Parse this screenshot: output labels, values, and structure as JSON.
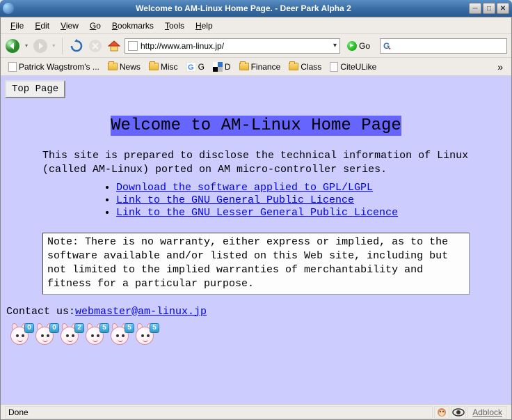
{
  "window": {
    "title": "Welcome to AM-Linux Home Page. - Deer Park Alpha 2"
  },
  "menubar": {
    "file": "File",
    "edit": "Edit",
    "view": "View",
    "go": "Go",
    "bookmarks": "Bookmarks",
    "tools": "Tools",
    "help": "Help"
  },
  "toolbar": {
    "url": "http://www.am-linux.jp/",
    "go_label": "Go",
    "search_value": ""
  },
  "bookmarks": [
    {
      "label": "Patrick Wagstrom's ...",
      "icon": "page"
    },
    {
      "label": "News",
      "icon": "folder"
    },
    {
      "label": "Misc",
      "icon": "folder"
    },
    {
      "label": "G",
      "icon": "g"
    },
    {
      "label": "D",
      "icon": "d"
    },
    {
      "label": "Finance",
      "icon": "folder"
    },
    {
      "label": "Class",
      "icon": "folder"
    },
    {
      "label": "CiteULike",
      "icon": "page"
    }
  ],
  "page": {
    "top_button": "Top Page",
    "heading": "Welcome to AM-Linux Home Page",
    "intro": "This site is prepared to disclose the technical information of Linux (called AM-Linux) ported on AM micro-controller series.",
    "links": [
      "Download the software applied to GPL/LGPL",
      "Link to the GNU General Public Licence",
      "Link to the GNU Lesser General Public Licence"
    ],
    "note": "Note: There is no warranty, either express or implied, as to the software available and/or listed on this Web site, including but not limited to the implied warranties of merchantability and fitness for a particular purpose.",
    "contact_label": "Contact us:",
    "contact_email": "webmaster@am-linux.jp",
    "counter": [
      "0",
      "0",
      "2",
      "5",
      "5",
      "5"
    ]
  },
  "statusbar": {
    "status": "Done",
    "adblock": "Adblock"
  }
}
